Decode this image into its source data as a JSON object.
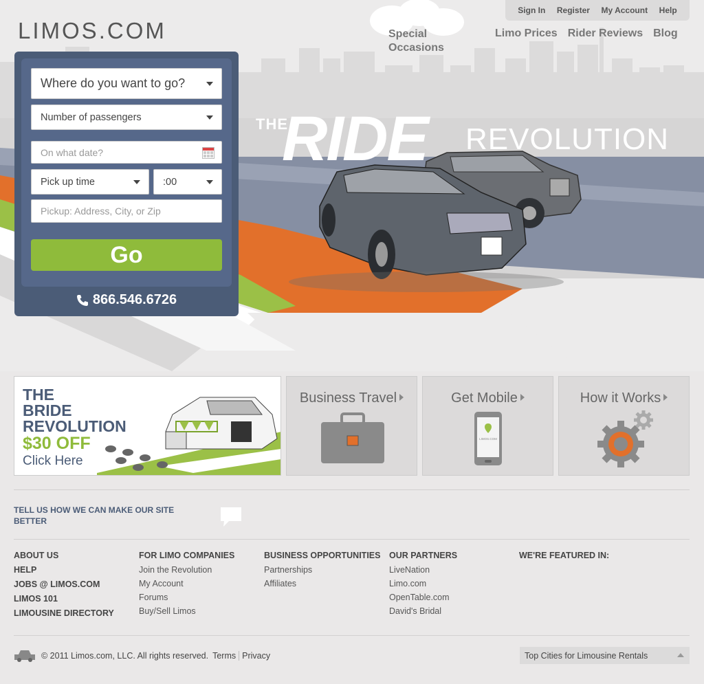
{
  "brand": {
    "logo": "LIMOS.COM"
  },
  "topbar": [
    "Sign In",
    "Register",
    "My Account",
    "Help"
  ],
  "nav": {
    "special": "Special Occasions",
    "items": [
      "Limo Prices",
      "Rider Reviews",
      "Blog"
    ]
  },
  "headline": {
    "the": "THE",
    "ride": "RIDE",
    "revolution": "REVOLUTION"
  },
  "booking": {
    "destination": "Where do you want to go?",
    "passengers": "Number of passengers",
    "date_placeholder": "On what date?",
    "pickup_time": "Pick up time",
    "minutes": ":00",
    "address_placeholder": "Pickup: Address, City, or Zip",
    "go": "Go",
    "phone": "866.546.6726"
  },
  "promo": {
    "bride": {
      "line1": "THE",
      "line2": "BRIDE",
      "line3": "REVOLUTION",
      "offer": "$30 OFF",
      "cta": "Click Here"
    },
    "tiles": [
      "Business Travel",
      "Get Mobile",
      "How it Works"
    ],
    "mobile_screen": "LIMOS.COM"
  },
  "feedback": "TELL US HOW WE CAN MAKE OUR SITE BETTER",
  "footer": {
    "col1": [
      "ABOUT US",
      "HELP",
      "JOBS @ LIMOS.COM",
      "LIMOS 101",
      "LIMOUSINE DIRECTORY"
    ],
    "col2": {
      "heading": "FOR LIMO COMPANIES",
      "links": [
        "Join the Revolution",
        "My Account",
        "Forums",
        "Buy/Sell Limos"
      ]
    },
    "col3": {
      "heading": "BUSINESS OPPORTUNITIES",
      "links": [
        "Partnerships",
        "Affiliates"
      ]
    },
    "col4": {
      "heading": "OUR PARTNERS",
      "links": [
        "LiveNation",
        "Limo.com",
        "OpenTable.com",
        "David's Bridal"
      ]
    },
    "col5": {
      "heading": "WE'RE FEATURED IN:"
    },
    "copyright": "© 2011  Limos.com, LLC. All rights reserved.",
    "terms": "Terms",
    "privacy": "Privacy",
    "cities": "Top Cities for Limousine Rentals"
  },
  "colors": {
    "navy": "#4b5c77",
    "green": "#8fbb3b",
    "orange": "#e2702b"
  }
}
